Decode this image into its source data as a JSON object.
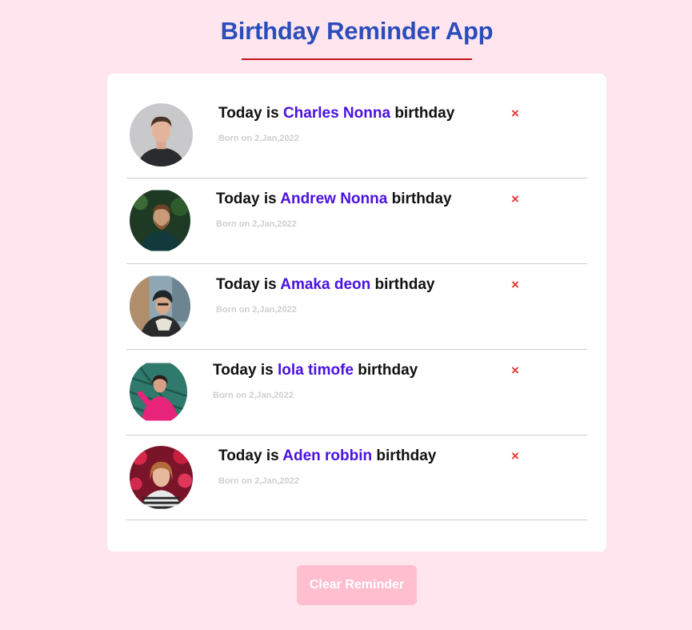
{
  "app": {
    "title": "Birthday Reminder App",
    "accent_color": "#2b4dbb",
    "underline_color": "#c4151c",
    "background": "#ffe6ee"
  },
  "reminders": [
    {
      "prefix": "Today is",
      "name": "Charles Nonna",
      "suffix": "birthday",
      "born": "Born on 2,Jan,2022",
      "delete_icon": "×"
    },
    {
      "prefix": "Today is",
      "name": "Andrew Nonna",
      "suffix": "birthday",
      "born": "Born on 2,Jan,2022",
      "delete_icon": "×"
    },
    {
      "prefix": "Today is",
      "name": "Amaka deon",
      "suffix": "birthday",
      "born": "Born on 2,Jan,2022",
      "delete_icon": "×"
    },
    {
      "prefix": "Today is",
      "name": "lola timofe",
      "suffix": "birthday",
      "born": "Born on 2,Jan,2022",
      "delete_icon": "×"
    },
    {
      "prefix": "Today is",
      "name": "Aden robbin",
      "suffix": "birthday",
      "born": "Born on 2,Jan,2022",
      "delete_icon": "×"
    }
  ],
  "clear_button": {
    "label": "Clear Reminder"
  }
}
